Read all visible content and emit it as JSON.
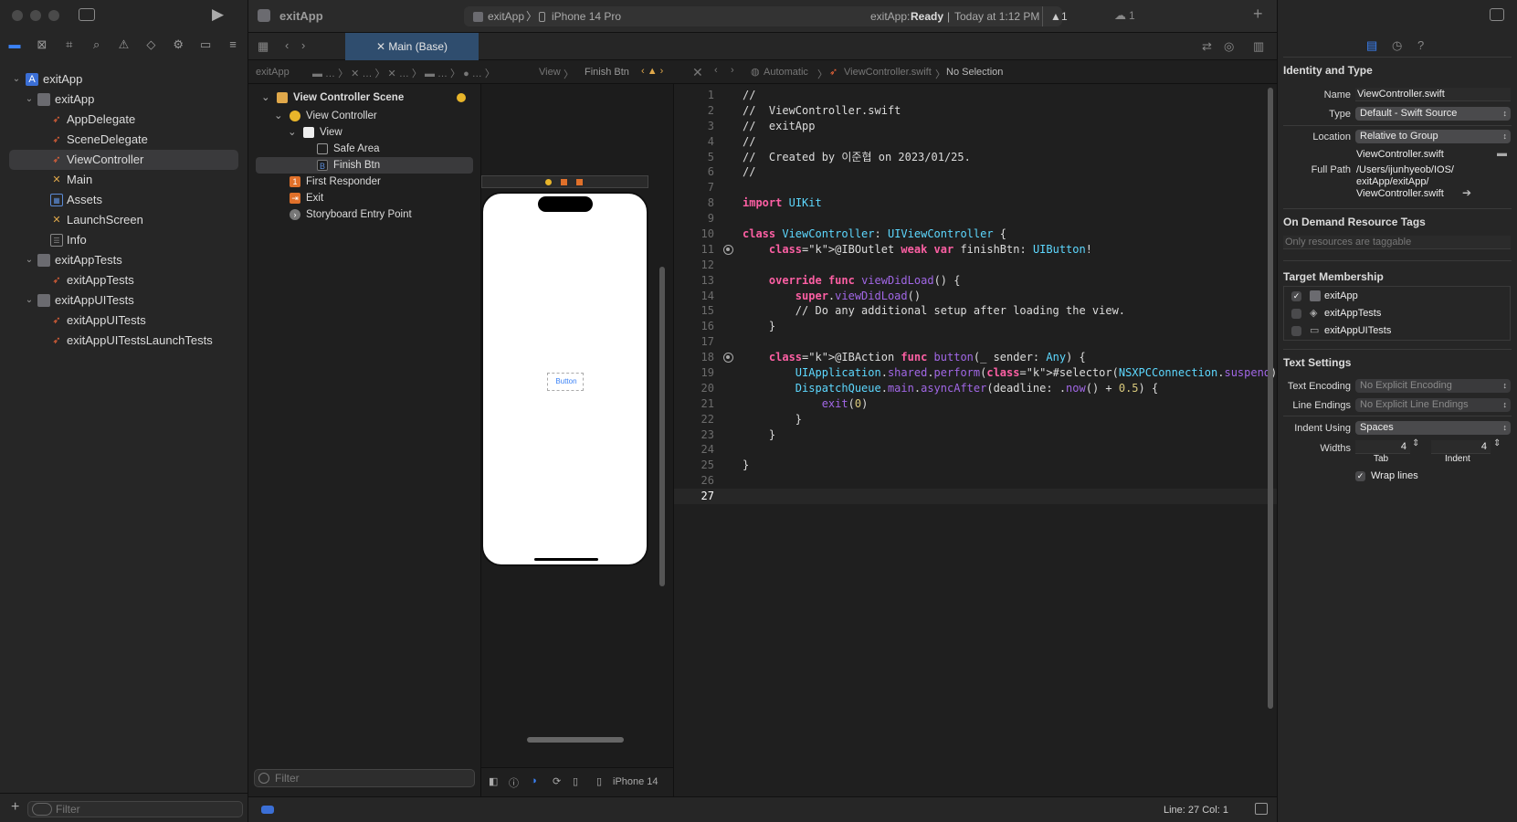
{
  "navigator": {
    "items": [
      {
        "label": "exitApp",
        "kind": "project"
      },
      {
        "label": "exitApp",
        "kind": "folder"
      },
      {
        "label": "AppDelegate",
        "kind": "swift"
      },
      {
        "label": "SceneDelegate",
        "kind": "swift"
      },
      {
        "label": "ViewController",
        "kind": "swift"
      },
      {
        "label": "Main",
        "kind": "storyboard"
      },
      {
        "label": "Assets",
        "kind": "assets"
      },
      {
        "label": "LaunchScreen",
        "kind": "storyboard"
      },
      {
        "label": "Info",
        "kind": "plist"
      },
      {
        "label": "exitAppTests",
        "kind": "folder"
      },
      {
        "label": "exitAppTests",
        "kind": "swift"
      },
      {
        "label": "exitAppUITests",
        "kind": "folder"
      },
      {
        "label": "exitAppUITests",
        "kind": "swift"
      },
      {
        "label": "exitAppUITestsLaunchTests",
        "kind": "swift"
      }
    ],
    "filter_placeholder": "Filter"
  },
  "toolbar": {
    "project": "exitApp",
    "scheme": "exitApp",
    "device": "iPhone 14 Pro",
    "status_app": "exitApp:",
    "status_state": "Ready",
    "status_time": "Today at 1:12 PM",
    "warnings": "1",
    "cloud": "1"
  },
  "tab": {
    "label": "Main (Base)"
  },
  "jumpbar_left": {
    "root": "exitApp",
    "view": "View",
    "item": "Finish Btn"
  },
  "jumpbar_right": {
    "mode": "Automatic",
    "file": "ViewController.swift",
    "selection": "No Selection"
  },
  "outline": {
    "scene": "View Controller Scene",
    "items": [
      "View Controller",
      "View",
      "Safe Area",
      "Finish Btn",
      "First Responder",
      "Exit",
      "Storyboard Entry Point"
    ],
    "filter_placeholder": "Filter"
  },
  "canvas": {
    "button_label": "Button",
    "device_label": "iPhone 14"
  },
  "code": {
    "lines": [
      "//",
      "//  ViewController.swift",
      "//  exitApp",
      "//",
      "//  Created by 이준협 on 2023/01/25.",
      "//",
      "",
      "import UIKit",
      "",
      "class ViewController: UIViewController {",
      "    @IBOutlet weak var finishBtn: UIButton!",
      "",
      "    override func viewDidLoad() {",
      "        super.viewDidLoad()",
      "        // Do any additional setup after loading the view.",
      "    }",
      "",
      "    @IBAction func button(_ sender: Any) {",
      "        UIApplication.shared.perform(#selector(NSXPCConnection.suspend))",
      "        DispatchQueue.main.asyncAfter(deadline: .now() + 0.5) {",
      "            exit(0)",
      "        }",
      "    }",
      "",
      "}",
      "",
      ""
    ],
    "line_numbers": [
      "1",
      "2",
      "3",
      "4",
      "5",
      "6",
      "7",
      "8",
      "9",
      "10",
      "11",
      "12",
      "13",
      "14",
      "15",
      "16",
      "17",
      "18",
      "19",
      "20",
      "21",
      "22",
      "23",
      "24",
      "25",
      "26",
      "27"
    ],
    "current_line": 27
  },
  "statusbar": {
    "position": "Line: 27  Col: 1"
  },
  "inspector": {
    "identity_title": "Identity and Type",
    "name_label": "Name",
    "name_value": "ViewController.swift",
    "type_label": "Type",
    "type_value": "Default - Swift Source",
    "location_label": "Location",
    "location_value": "Relative to Group",
    "location_file": "ViewController.swift",
    "fullpath_label": "Full Path",
    "fullpath_1": "/Users/ijunhyeob/IOS/",
    "fullpath_2": "exitApp/exitApp/",
    "fullpath_3": "ViewController.swift",
    "ondemand_title": "On Demand Resource Tags",
    "ondemand_placeholder": "Only resources are taggable",
    "target_title": "Target Membership",
    "targets": [
      {
        "label": "exitApp",
        "checked": true
      },
      {
        "label": "exitAppTests",
        "checked": false
      },
      {
        "label": "exitAppUITests",
        "checked": false
      }
    ],
    "text_title": "Text Settings",
    "encoding_label": "Text Encoding",
    "encoding_value": "No Explicit Encoding",
    "endings_label": "Line Endings",
    "endings_value": "No Explicit Line Endings",
    "indent_label": "Indent Using",
    "indent_value": "Spaces",
    "widths_label": "Widths",
    "tab_value": "4",
    "indent_value_num": "4",
    "tab_caption": "Tab",
    "indent_caption": "Indent",
    "wrap_label": "Wrap lines"
  }
}
